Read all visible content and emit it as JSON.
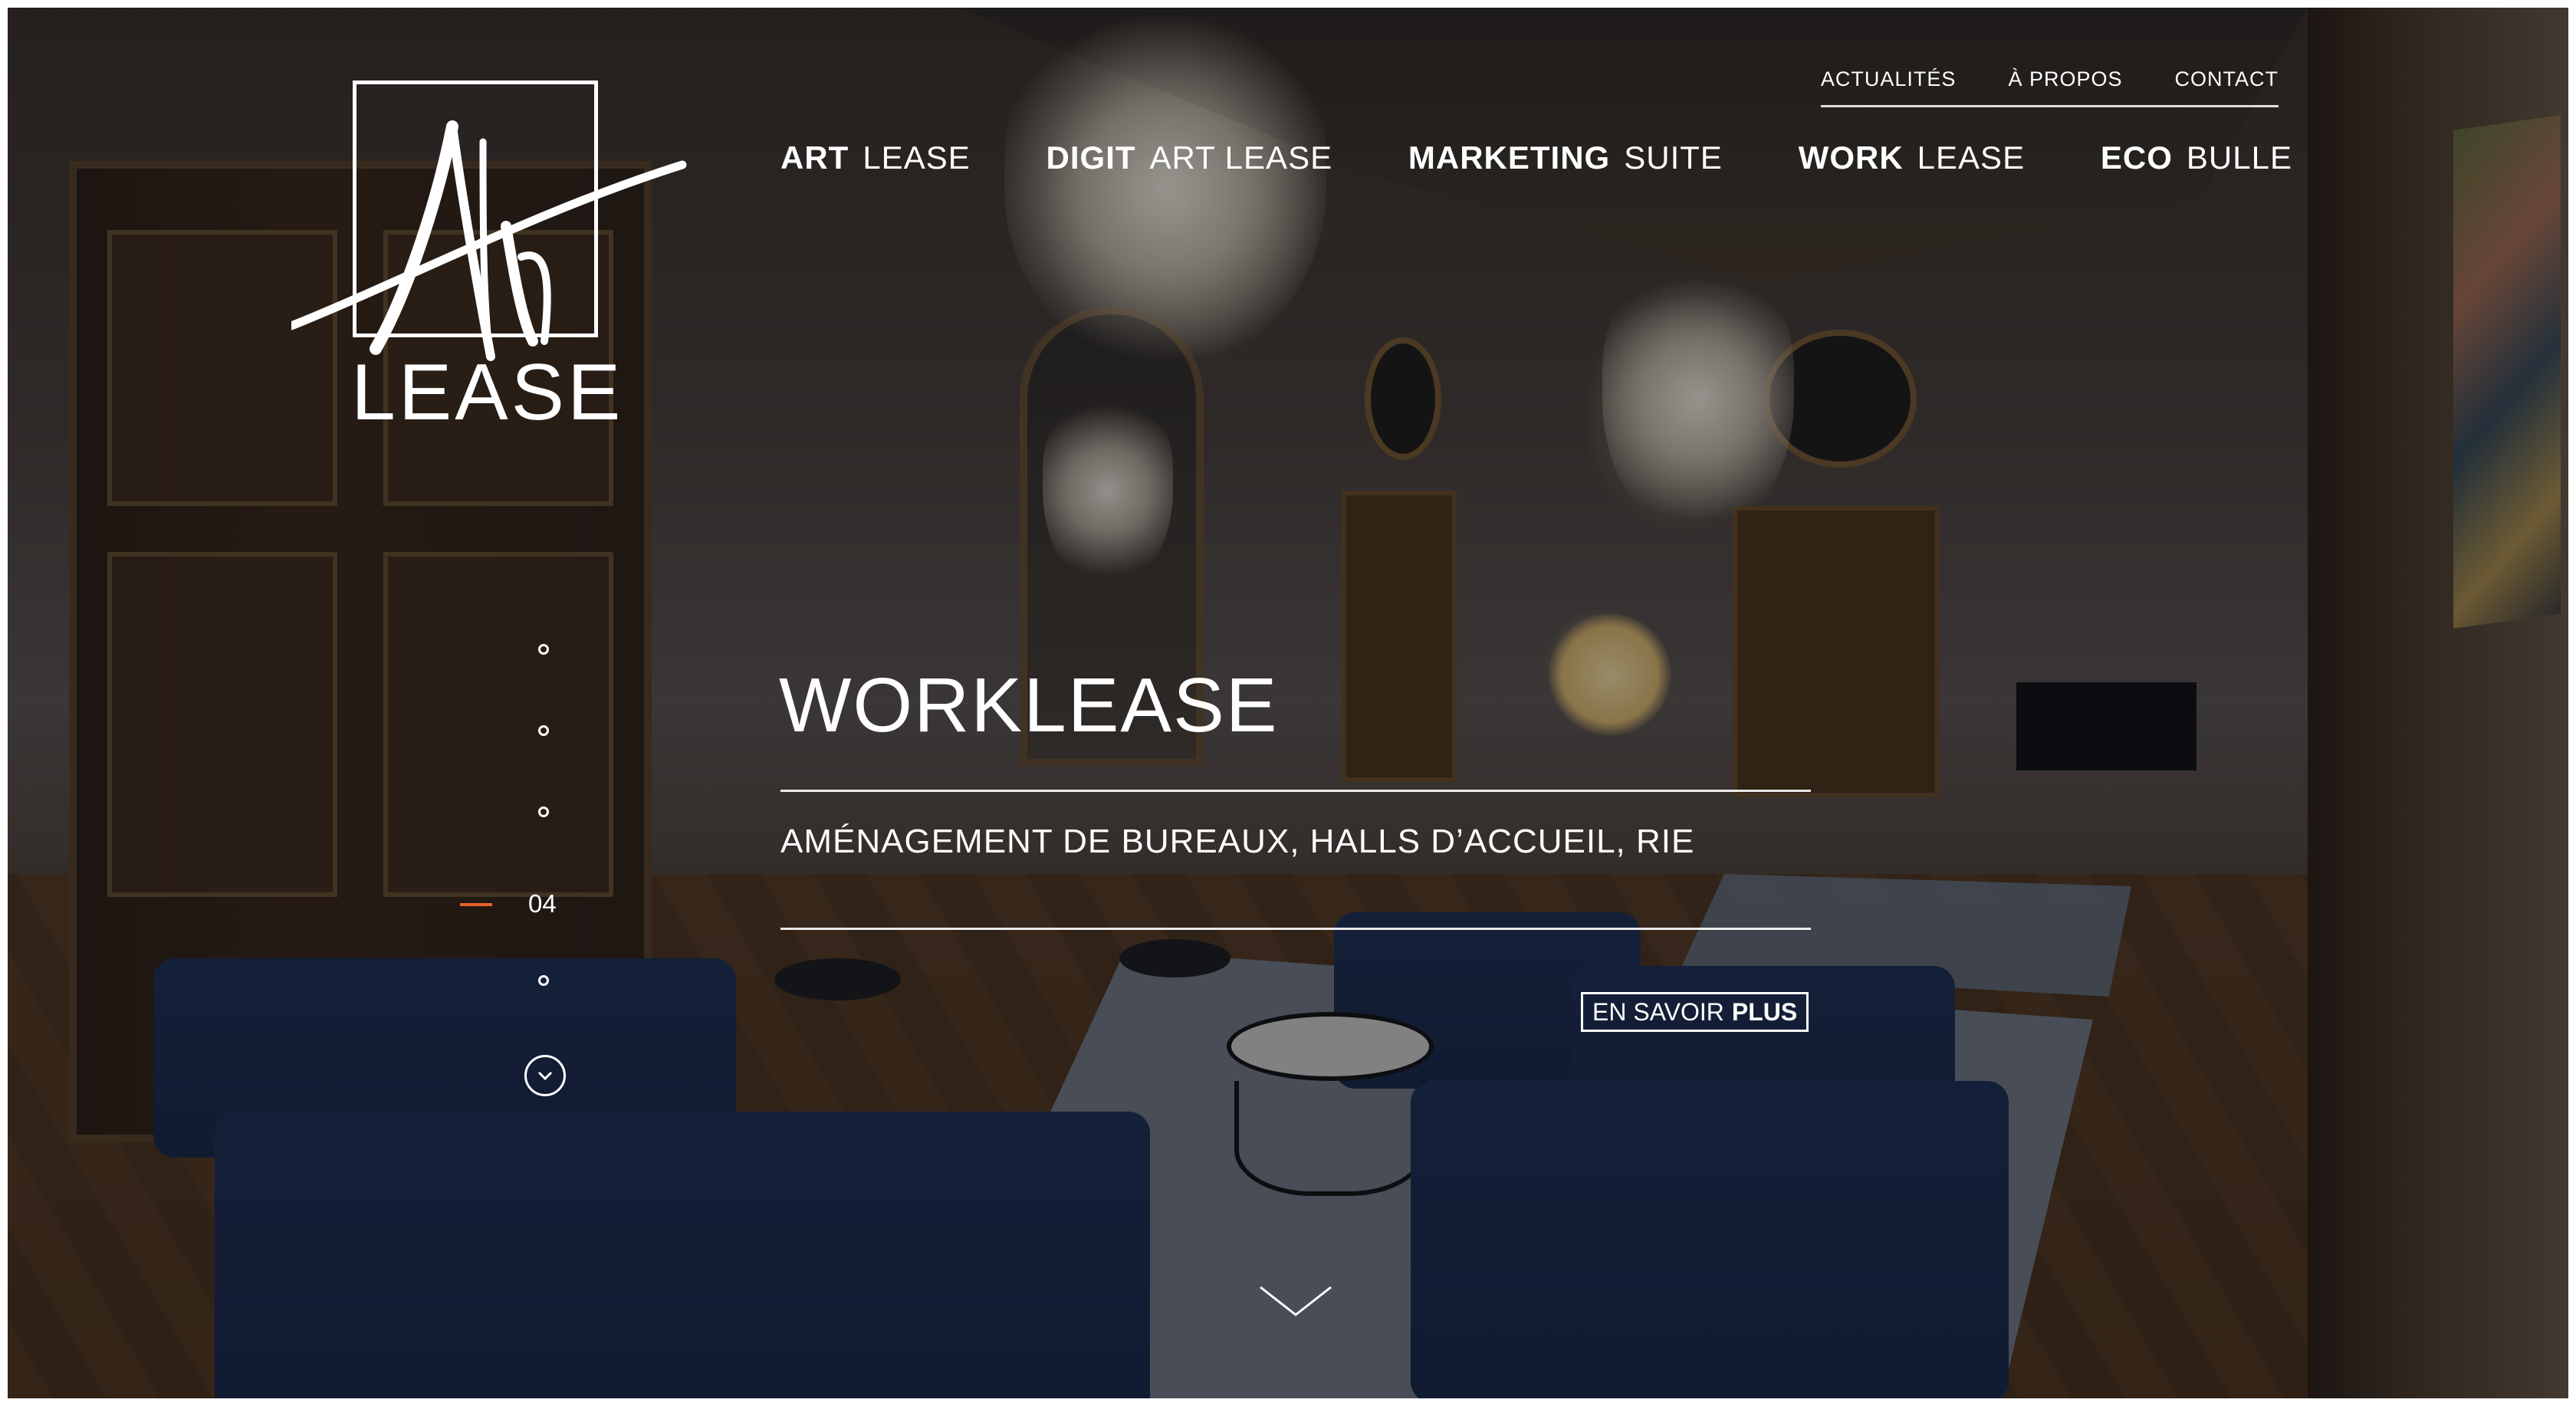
{
  "brand": {
    "logo_word": "LEASE",
    "logo_script": "Art"
  },
  "top_nav": [
    {
      "label": "ACTUALITÉS"
    },
    {
      "label": "À PROPOS"
    },
    {
      "label": "CONTACT"
    }
  ],
  "main_nav": [
    {
      "bold": "ART",
      "light": "LEASE"
    },
    {
      "bold": "DIGIT",
      "light": "ART LEASE"
    },
    {
      "bold": "MARKETING",
      "light": "SUITE"
    },
    {
      "bold": "WORK",
      "light": "LEASE"
    },
    {
      "bold": "ECO",
      "light": "BULLE"
    }
  ],
  "pager": {
    "current": "04",
    "total_slides": 5,
    "accent_color": "#e8622c",
    "down_icon": "chevron-down-icon"
  },
  "hero": {
    "title": "WORKLEASE",
    "subtitle": "AMÉNAGEMENT DE BUREAUX, HALLS D’ACCUEIL, RIE",
    "cta_regular": "EN SAVOIR",
    "cta_bold": "PLUS"
  },
  "scroll_icon": "chevron-down-icon"
}
